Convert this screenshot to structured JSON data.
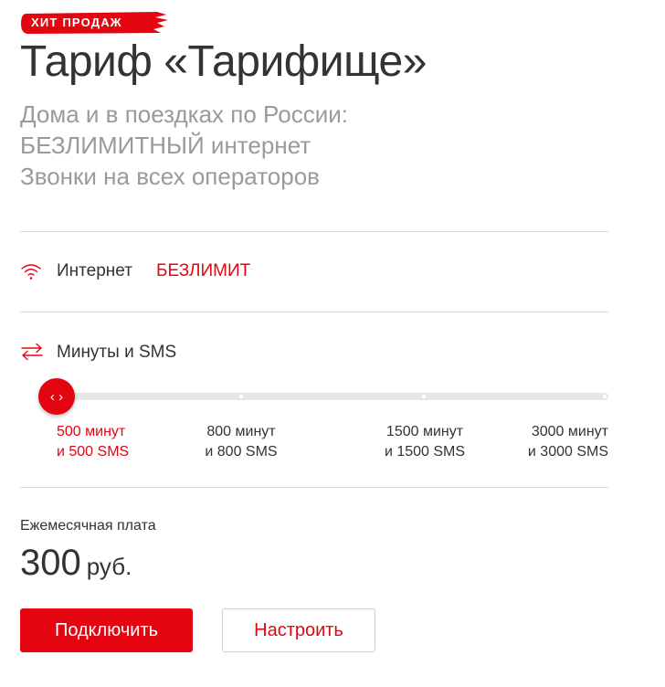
{
  "badge": {
    "label": "ХИТ ПРОДАЖ"
  },
  "tariff": {
    "title": "Тариф «Тарифище»",
    "subtitle": [
      "Дома и в поездках по России:",
      "БЕЗЛИМИТНЫЙ интернет",
      "Звонки на всех операторов"
    ]
  },
  "internet": {
    "label": "Интернет",
    "value": "БЕЗЛИМИТ",
    "icon": "wifi-icon"
  },
  "minutes": {
    "label": "Минуты и SMS",
    "icon": "swap-arrows-icon",
    "slider": {
      "thumb_glyph": "‹ ›",
      "selected_index": 0,
      "options": [
        {
          "line1": "500 минут",
          "line2": "и 500 SMS"
        },
        {
          "line1": "800 минут",
          "line2": "и 800 SMS"
        },
        {
          "line1": "1500 минут",
          "line2": "и 1500 SMS"
        },
        {
          "line1": "3000 минут",
          "line2": "и 3000 SMS"
        }
      ]
    }
  },
  "fee": {
    "label": "Ежемесячная плата",
    "amount": "300",
    "currency": "руб."
  },
  "actions": {
    "connect": "Подключить",
    "configure": "Настроить"
  },
  "colors": {
    "accent": "#e30611",
    "muted": "#9a9a9a",
    "text": "#333333",
    "divider": "#d9d9d9"
  }
}
